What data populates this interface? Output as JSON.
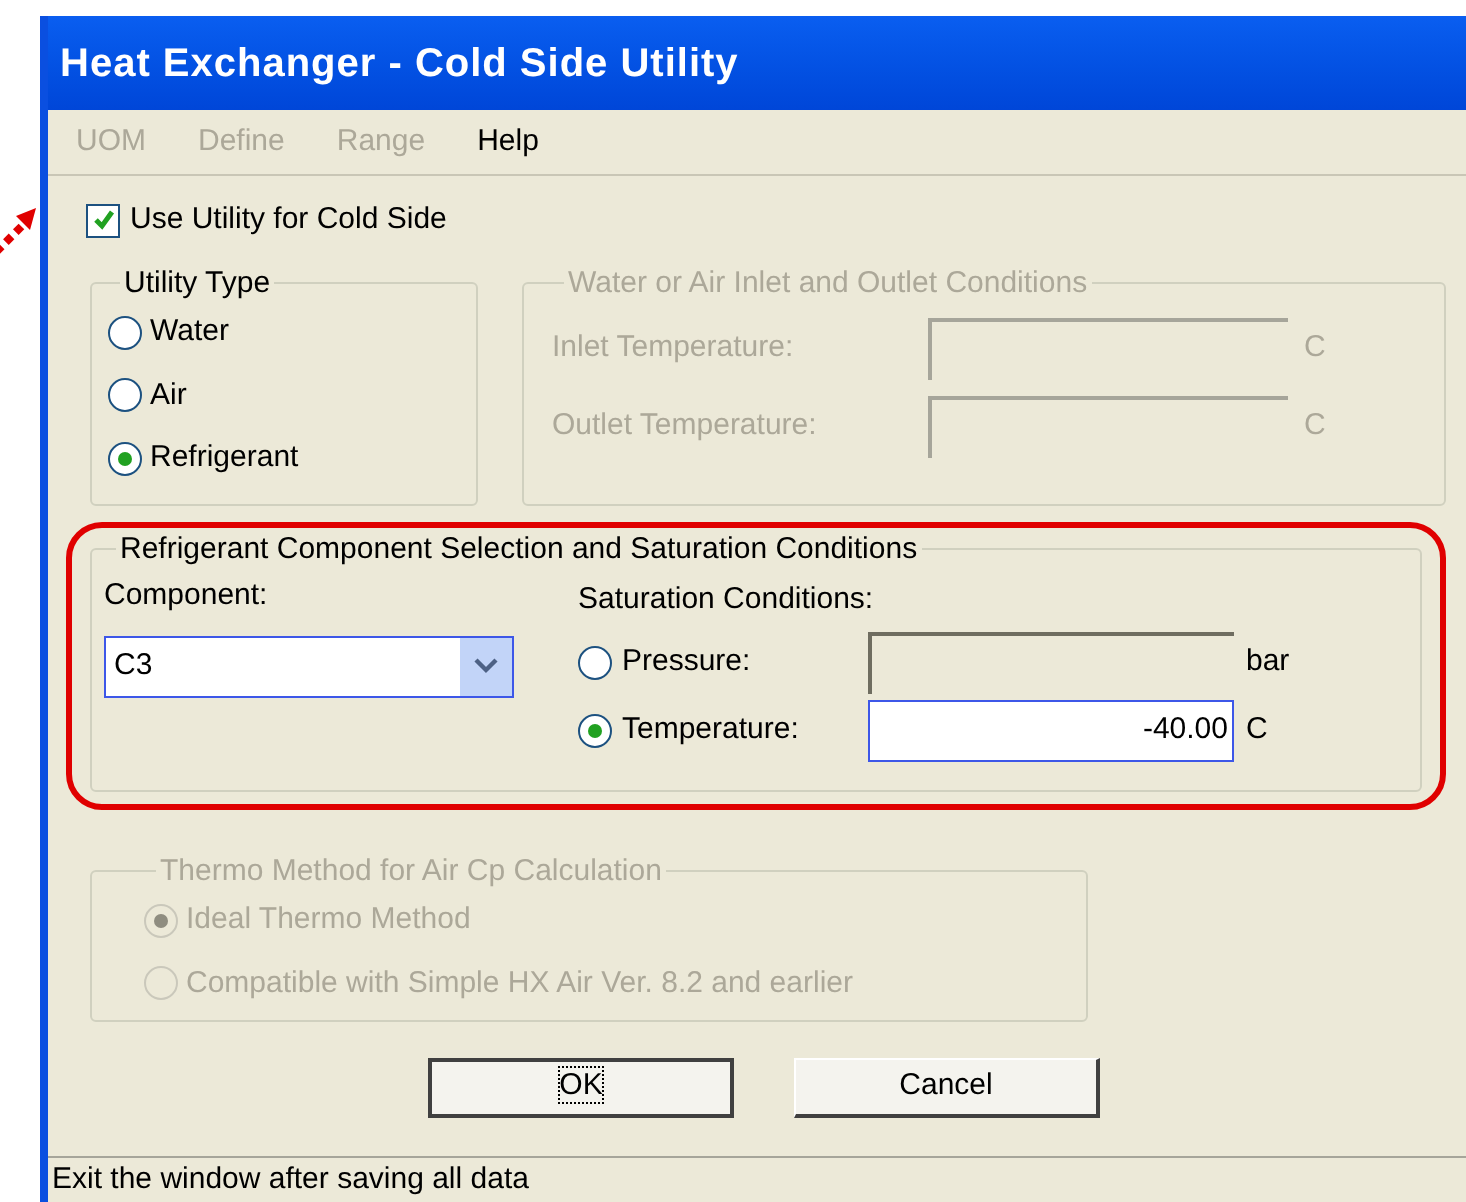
{
  "window": {
    "title": "Heat Exchanger - Cold Side Utility"
  },
  "menu": [
    {
      "label": "UOM",
      "disabled": true
    },
    {
      "label": "Define",
      "disabled": true
    },
    {
      "label": "Range",
      "disabled": true
    },
    {
      "label": "Help",
      "disabled": false
    }
  ],
  "use_utility": {
    "label": "Use Utility for Cold Side",
    "checked": true
  },
  "utility_type": {
    "title": "Utility Type",
    "options": [
      {
        "label": "Water",
        "selected": false
      },
      {
        "label": "Air",
        "selected": false
      },
      {
        "label": "Refrigerant",
        "selected": true
      }
    ]
  },
  "inlet_outlet": {
    "title": "Water or Air Inlet and Outlet Conditions",
    "disabled": true,
    "fields": [
      {
        "label": "Inlet Temperature:",
        "unit": "C"
      },
      {
        "label": "Outlet Temperature:",
        "unit": "C"
      }
    ]
  },
  "refrigerant": {
    "title": "Refrigerant Component Selection and Saturation Conditions",
    "component_label": "Component:",
    "component": "C3",
    "saturation_label": "Saturation Conditions:",
    "conditions": [
      {
        "label": "Pressure:",
        "selected": false,
        "unit": "bar"
      },
      {
        "label": "Temperature:",
        "selected": true,
        "value": "-40.00",
        "unit": "C"
      }
    ]
  },
  "thermo": {
    "title": "Thermo Method for Air Cp Calculation",
    "disabled": true,
    "options": [
      {
        "label": "Ideal Thermo Method",
        "selected": true
      },
      {
        "label": "Compatible with Simple HX Air Ver. 8.2 and earlier",
        "selected": false
      }
    ]
  },
  "buttons": [
    {
      "label": "OK",
      "focused": true
    },
    {
      "label": "Cancel",
      "focused": false
    }
  ],
  "status_bar": "Exit the window after saving all data"
}
